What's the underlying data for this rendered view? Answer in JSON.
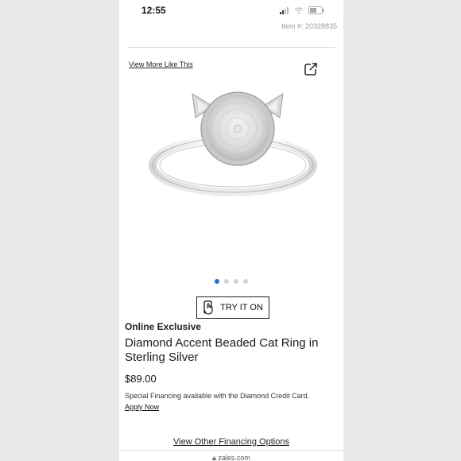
{
  "status_bar": {
    "time": "12:55",
    "signal_icon": "cell-signal-icon",
    "wifi_icon": "wifi-icon",
    "battery_icon": "battery-icon"
  },
  "header": {
    "item_number": "Item #: 20328835"
  },
  "links": {
    "view_more": "View More Like This"
  },
  "share": {
    "icon": "share-icon"
  },
  "carousel": {
    "slides": 4,
    "active_index": 0
  },
  "try_on": {
    "label": "TRY IT ON",
    "icon": "hand-phone-icon"
  },
  "product": {
    "badge": "Online Exclusive",
    "title": "Diamond Accent Beaded Cat Ring in Sterling Silver",
    "price": "$89.00",
    "financing_note": "Special Financing available with the Diamond Credit Card.",
    "apply_now": "Apply Now",
    "view_financing": "View Other Financing Options"
  },
  "browser": {
    "url": "zales.com"
  },
  "colors": {
    "accent": "#1f6fc6",
    "text": "#222222",
    "background": "#ffffff",
    "page_backdrop": "#e9eaec"
  }
}
